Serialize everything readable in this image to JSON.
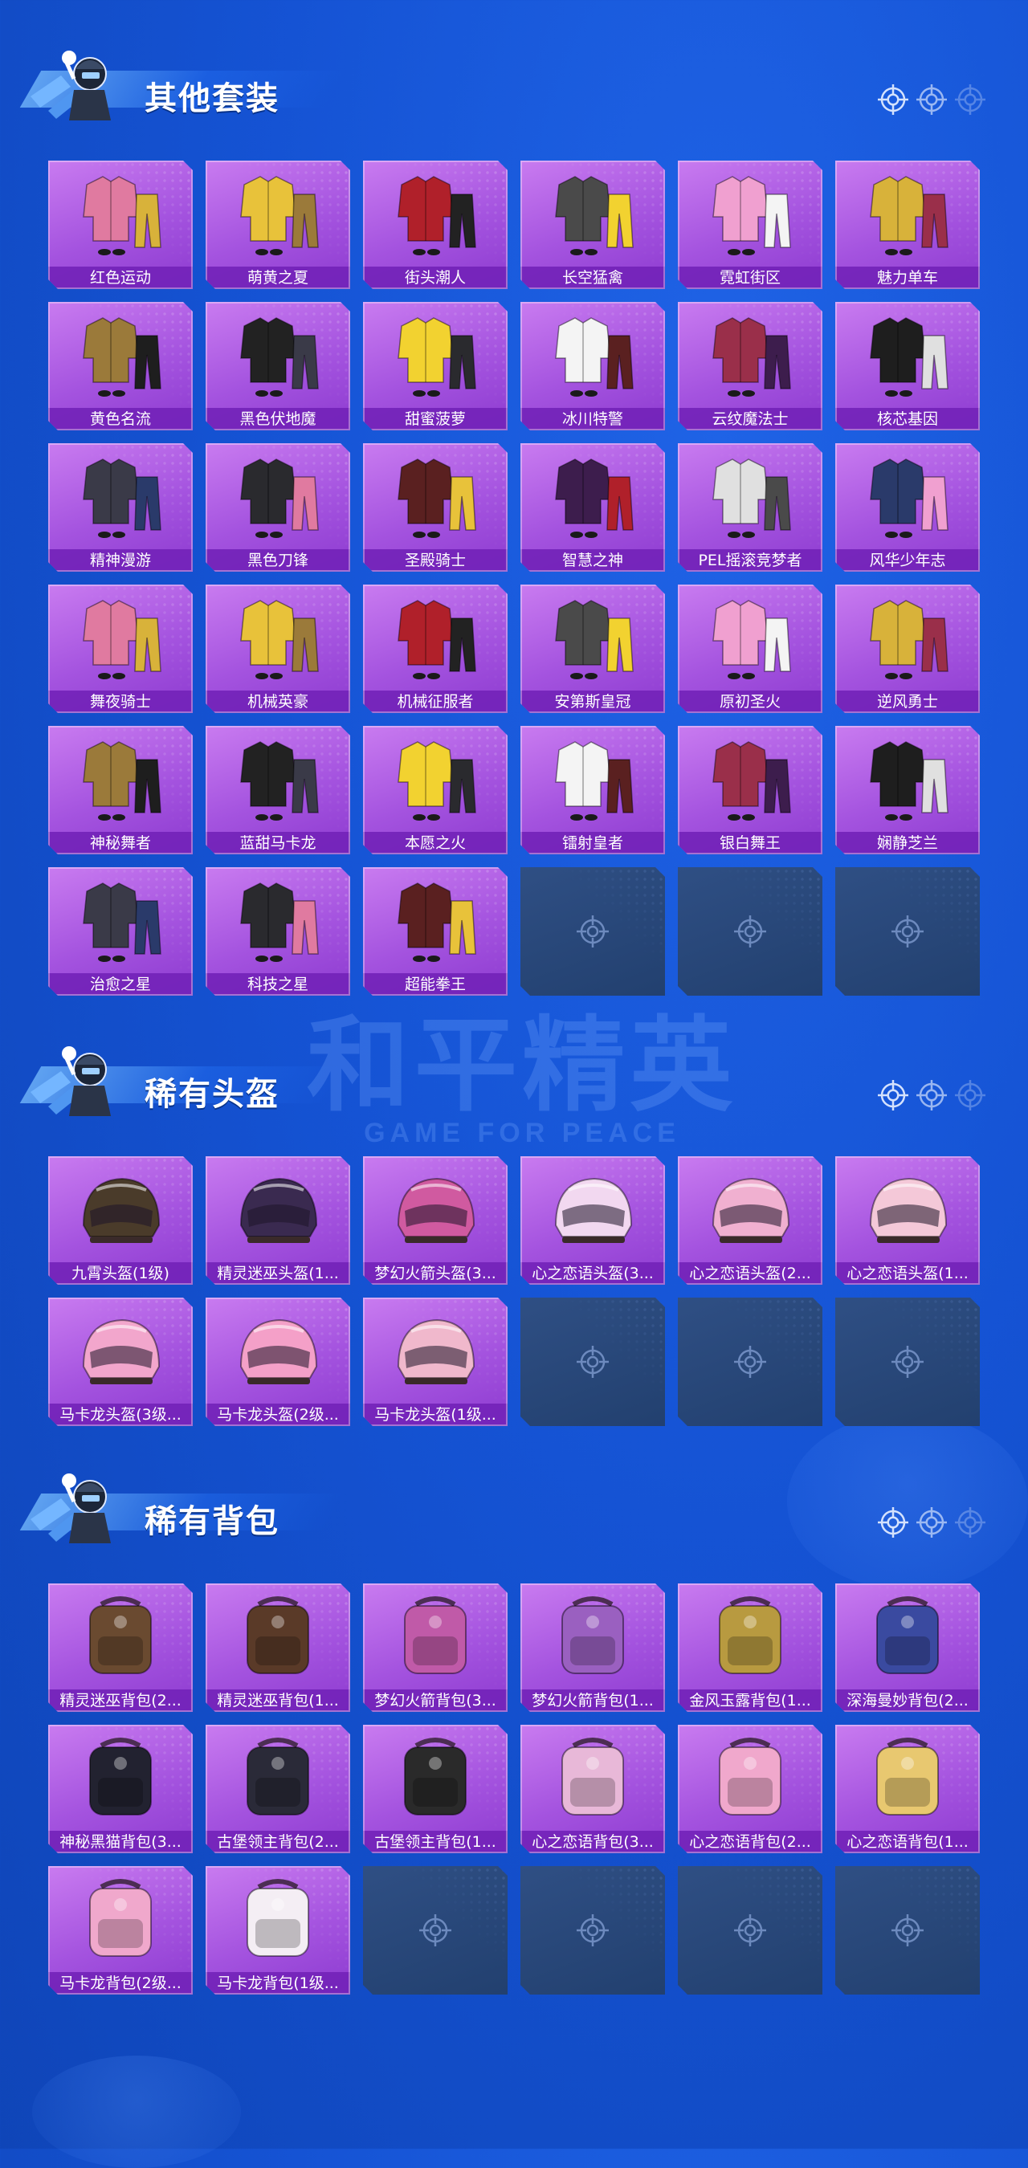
{
  "watermark": {
    "cn": "和平精英",
    "en": "GAME FOR PEACE"
  },
  "colors": {
    "background": "#1553d4",
    "tile_purple": "#a453df",
    "label_bar": "#7323b9",
    "empty_tile": "#2a4776"
  },
  "sections": [
    {
      "title": "其他套装",
      "kind": "outfit",
      "items": [
        "红色运动",
        "萌黄之夏",
        "街头潮人",
        "长空猛禽",
        "霓虹街区",
        "魅力单车",
        "黄色名流",
        "黑色伏地魔",
        "甜蜜菠萝",
        "冰川特警",
        "云纹魔法士",
        "核芯基因",
        "精神漫游",
        "黑色刀锋",
        "圣殿骑士",
        "智慧之神",
        "PEL摇滚竞梦者",
        "风华少年志",
        "舞夜骑士",
        "机械英豪",
        "机械征服者",
        "安第斯皇冠",
        "原初圣火",
        "逆风勇士",
        "神秘舞者",
        "蓝甜马卡龙",
        "本愿之火",
        "镭射皇者",
        "银白舞王",
        "娴静芝兰",
        "治愈之星",
        "科技之星",
        "超能拳王"
      ],
      "empty_slots": 3
    },
    {
      "title": "稀有头盔",
      "kind": "helmet",
      "items": [
        "九霄头盔(1级)",
        "精灵迷巫头盔(1...",
        "梦幻火箭头盔(3...",
        "心之恋语头盔(3...",
        "心之恋语头盔(2...",
        "心之恋语头盔(1...",
        "马卡龙头盔(3级...",
        "马卡龙头盔(2级...",
        "马卡龙头盔(1级..."
      ],
      "empty_slots": 3
    },
    {
      "title": "稀有背包",
      "kind": "backpack",
      "items": [
        "精灵迷巫背包(2...",
        "精灵迷巫背包(1...",
        "梦幻火箭背包(3...",
        "梦幻火箭背包(1...",
        "金风玉露背包(1...",
        "深海曼妙背包(2...",
        "神秘黑猫背包(3...",
        "古堡领主背包(2...",
        "古堡领主背包(1...",
        "心之恋语背包(3...",
        "心之恋语背包(2...",
        "心之恋语背包(1...",
        "马卡龙背包(2级...",
        "马卡龙背包(1级..."
      ],
      "empty_slots": 4
    }
  ]
}
